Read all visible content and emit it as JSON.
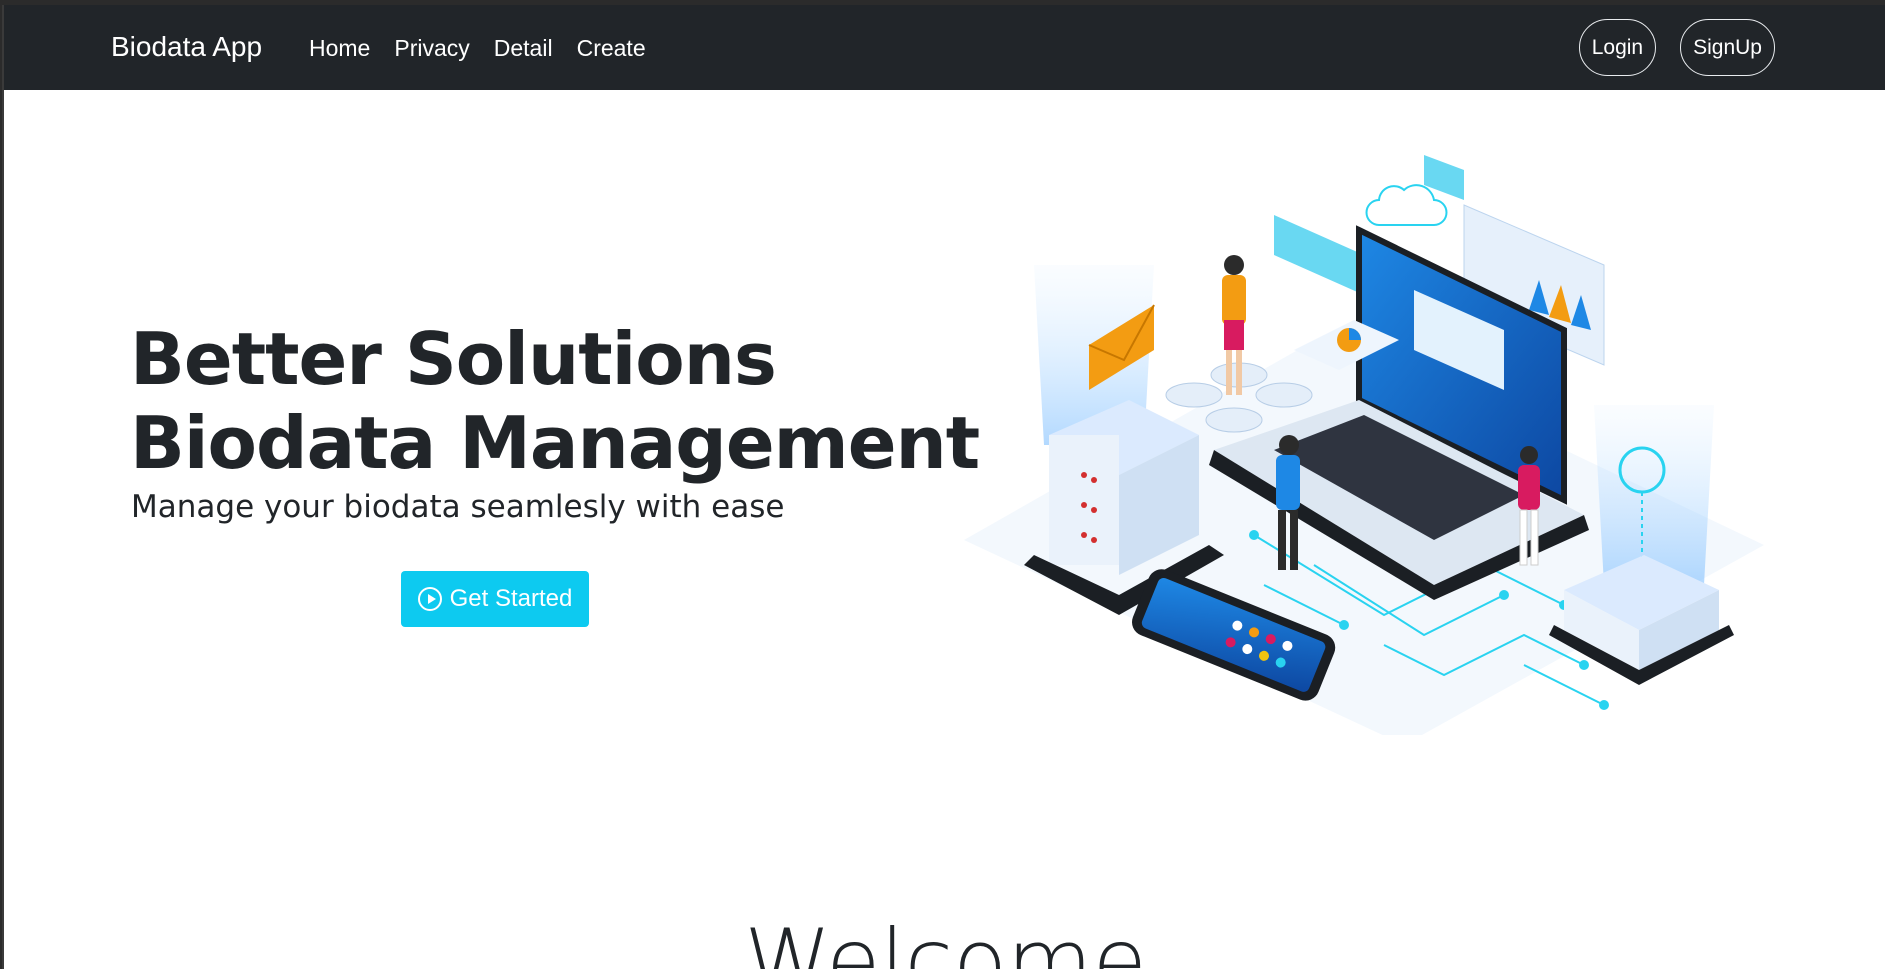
{
  "navbar": {
    "brand": "Biodata App",
    "links": [
      "Home",
      "Privacy",
      "Detail",
      "Create"
    ],
    "login_label": "Login",
    "signup_label": "SignUp"
  },
  "hero": {
    "title_line1": "Better Solutions",
    "title_line2": "Biodata Management",
    "subtitle": "Manage your biodata seamlesly with ease",
    "cta_label": "Get Started",
    "cta_icon": "play-circle-icon",
    "illustration": "isometric-laptop-servers-illustration"
  },
  "welcome": {
    "heading": "Welcome"
  },
  "colors": {
    "navbar_bg": "#212529",
    "accent": "#0dcaf0",
    "text": "#212529"
  }
}
